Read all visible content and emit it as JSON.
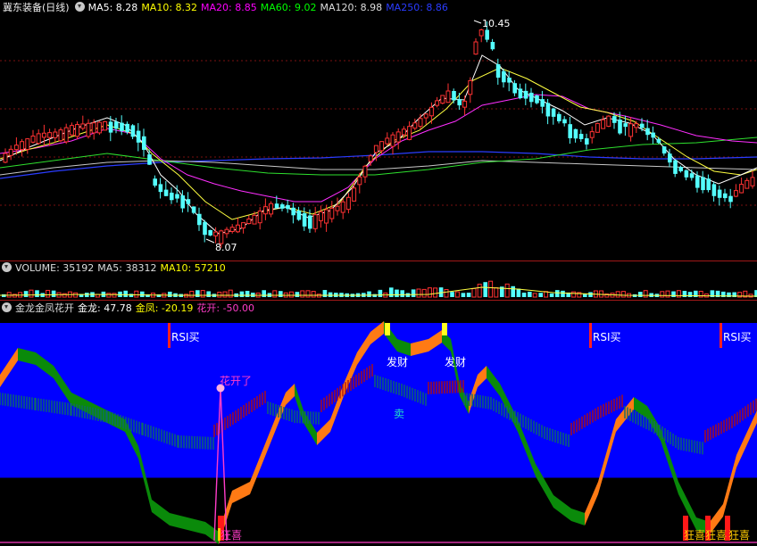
{
  "price_panel": {
    "title": "冀东装备(日线)",
    "ma": [
      {
        "label": "MA5: 8.28",
        "color": "#ffffff"
      },
      {
        "label": "MA10: 8.32",
        "color": "#ffff00"
      },
      {
        "label": "MA20: 8.85",
        "color": "#ff00ff"
      },
      {
        "label": "MA60: 9.02",
        "color": "#00ff00"
      },
      {
        "label": "MA120: 8.98",
        "color": "#d8d8d8"
      },
      {
        "label": "MA250: 8.86",
        "color": "#2a3cff"
      }
    ],
    "high_label": "10.45",
    "low_label": "8.07"
  },
  "volume_panel": {
    "items": [
      {
        "label": "VOLUME: 35192",
        "color": "#dddddd"
      },
      {
        "label": "MA5: 38312",
        "color": "#dddddd"
      },
      {
        "label": "MA10: 57210",
        "color": "#ffff00"
      }
    ]
  },
  "indicator_panel": {
    "name": "金龙金凤花开",
    "items": [
      {
        "label": "金龙: 47.78",
        "color": "#ffffff"
      },
      {
        "label": "金凤: -20.19",
        "color": "#ffff00"
      },
      {
        "label": "花开: -50.00",
        "color": "#ff3cc8"
      }
    ],
    "signals": {
      "rsi_buy": [
        "RSI买",
        "RSI买",
        "RSI买"
      ],
      "fa_cai": [
        "发财",
        "发财"
      ],
      "sell": "卖",
      "hua_kai": "花开了",
      "kuang_xi": [
        "狂喜",
        "狂喜",
        "狂喜",
        "狂喜"
      ]
    }
  },
  "colors": {
    "up": "#ff3232",
    "down": "#54ffff",
    "indicator_bg": "#0000ff",
    "dragon_up": "#ff7a14",
    "dragon_down": "#0a8a0a"
  }
}
